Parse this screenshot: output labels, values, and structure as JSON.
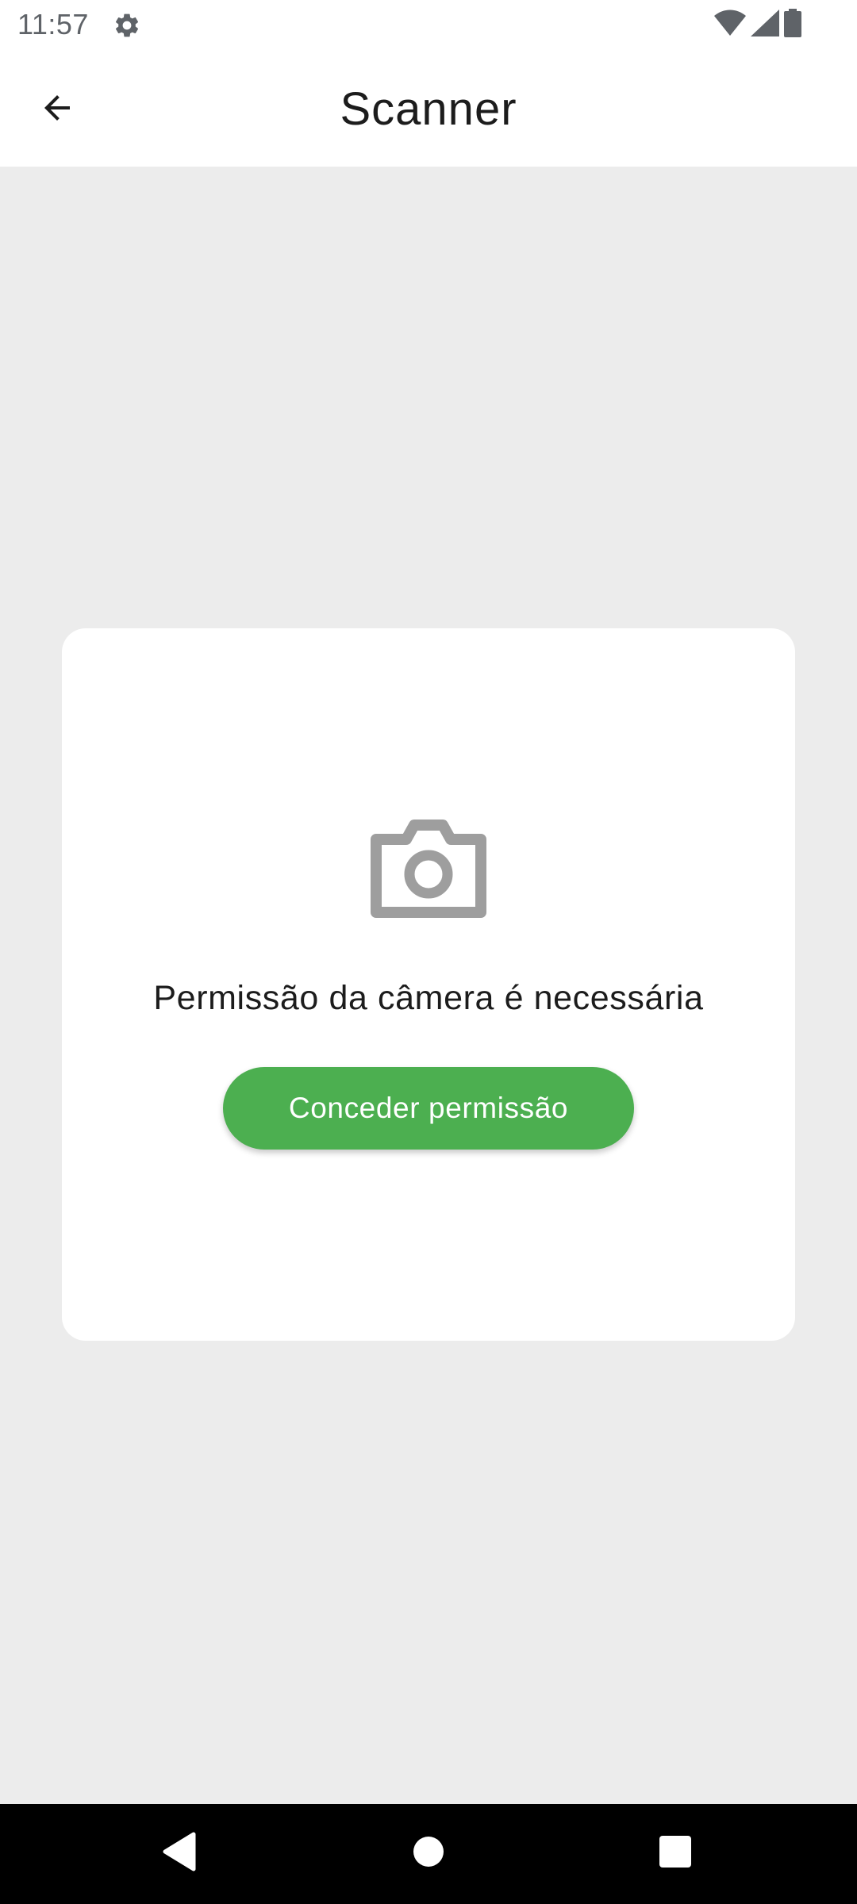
{
  "status_bar": {
    "time": "11:57",
    "icons": [
      "settings-icon",
      "wifi-icon",
      "signal-icon",
      "battery-icon"
    ]
  },
  "header": {
    "title": "Scanner",
    "back_icon": "arrow-back-icon"
  },
  "permission_card": {
    "icon": "camera-icon",
    "message": "Permissão da câmera é necessária",
    "button_label": "Conceder permissão"
  },
  "colors": {
    "accent": "#4caf50",
    "background": "#ececec",
    "card": "#ffffff",
    "icon_gray": "#9e9e9e"
  },
  "nav_bar": {
    "buttons": [
      "back-triangle-icon",
      "home-circle-icon",
      "recents-square-icon"
    ]
  }
}
